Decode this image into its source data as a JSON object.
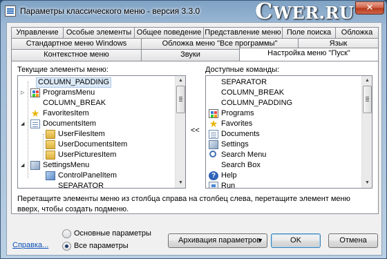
{
  "window": {
    "title": "Параметры классического меню - версия 3.3.0",
    "watermark": "CWER.RU",
    "close": "✕"
  },
  "tabs": {
    "row1": [
      "Управление",
      "Особые элементы",
      "Общее поведение",
      "Представление меню",
      "Поле поиска",
      "Обложка"
    ],
    "row2": [
      "Стандартное меню Windows",
      "Обложка меню \"Все программы\"",
      "Язык"
    ],
    "row3": [
      "Контекстное меню",
      "Звуки",
      "Настройка меню \"Пуск\""
    ]
  },
  "current": {
    "label": "Текущие элементы меню:",
    "items": [
      {
        "text": "COLUMN_PADDING",
        "icon": "none"
      },
      {
        "text": "ProgramsMenu",
        "icon": "programs-icon"
      },
      {
        "text": "COLUMN_BREAK",
        "icon": "none"
      },
      {
        "text": "FavoritesItem",
        "icon": "star-icon"
      },
      {
        "text": "DocumentsItem",
        "icon": "documents-icon"
      },
      {
        "text": "UserFilesItem",
        "icon": "folder-icon"
      },
      {
        "text": "UserDocumentsItem",
        "icon": "folder-icon"
      },
      {
        "text": "UserPicturesItem",
        "icon": "folder-icon"
      },
      {
        "text": "SettingsMenu",
        "icon": "settings-icon"
      },
      {
        "text": "ControlPanelItem",
        "icon": "control-panel-icon"
      },
      {
        "text": "SEPARATOR",
        "icon": "none"
      }
    ]
  },
  "available": {
    "label": "Доступные команды:",
    "items": [
      {
        "text": "SEPARATOR",
        "icon": "none"
      },
      {
        "text": "COLUMN_BREAK",
        "icon": "none"
      },
      {
        "text": "COLUMN_PADDING",
        "icon": "none"
      },
      {
        "text": "Programs",
        "icon": "programs-icon"
      },
      {
        "text": "Favorites",
        "icon": "star-icon"
      },
      {
        "text": "Documents",
        "icon": "documents-icon"
      },
      {
        "text": "Settings",
        "icon": "settings-icon"
      },
      {
        "text": "Search Menu",
        "icon": "search-icon"
      },
      {
        "text": "Search Box",
        "icon": "none"
      },
      {
        "text": "Help",
        "icon": "help-icon"
      },
      {
        "text": "Run",
        "icon": "run-icon"
      }
    ]
  },
  "move_button": "<<",
  "description": "Перетащите элементы меню из столбца справа на столбец слева, перетащите элемент меню вверх, чтобы создать подменю.",
  "options": {
    "basic": "Основные параметры",
    "all": "Все параметры",
    "selected": "all"
  },
  "footer": {
    "help_link": "Справка...",
    "backup_button": "Архивация параметров",
    "ok_button": "OK",
    "cancel_button": "Отмена"
  }
}
